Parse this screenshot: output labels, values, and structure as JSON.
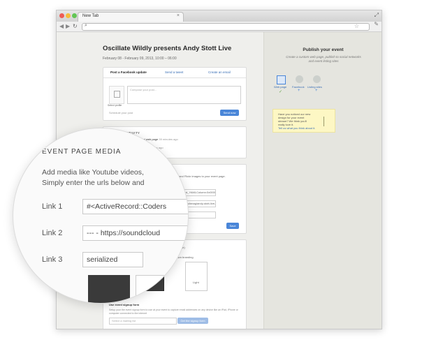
{
  "browser": {
    "tab_title": "New Tab",
    "tab_close": "×",
    "expand_glyph": "⤢",
    "back_glyph": "◀",
    "forward_glyph": "▶",
    "reload_glyph": "↻",
    "search_glyph": "⌕",
    "star_glyph": "☆",
    "wrench_glyph": "✎"
  },
  "event": {
    "title": "Oscillate Wildly presents Andy Stott Live",
    "date": "February 08 - February 09, 2013, 10:00 – 06:00"
  },
  "post_card": {
    "tabs": [
      "Post a Facebook update",
      "Send a tweet",
      "Create an email"
    ],
    "select_profile": "Select profile",
    "placeholder": "Compose your post...",
    "schedule": "Schedule your post",
    "send_button": "Send now"
  },
  "activity": {
    "title": "RECENT ACTIVITY",
    "items": [
      {
        "text": "You published your event web page",
        "time": "39 minutes ago"
      },
      {
        "text": "You created your event:",
        "time": "39 minutes ago"
      }
    ]
  },
  "media": {
    "description_tail": "...ideo, SoundCloud tracks and Flickr images to your event page.",
    "description_tail2": "...and hit Save.",
    "link1": "...ecord::Relation::ActiveRecord_YAMLColumn:0x00000007f43a4>",
    "link2": "...https://soundcloud.com/swifttechmag/andy-stott-live-moogfe",
    "save_button": "Save"
  },
  "design": {
    "title": "YOUR EVENT WEB PAGE",
    "view_link": "(view page)",
    "hint": "...event page to match your own branding",
    "dark_label": "Dark",
    "light_label": "Light",
    "signup_title": "Use event signup form",
    "signup_text": "Setup your the event signup form to use at your event to capture email addresses on any device like an iPad, iPhone or computer connected to the internet",
    "select_placeholder": "Select a mailing list",
    "signup_button": "Get the signup form"
  },
  "sidebar": {
    "title": "Publish your event",
    "desc": "Create a custom web page, publish to social networks and event listing sites",
    "channels": [
      {
        "label": "Web page",
        "mark": "✓"
      },
      {
        "label": "Facebook",
        "mark": "+"
      },
      {
        "label": "Listing sites",
        "mark": "+"
      }
    ],
    "note_lines": [
      "Have you noticed our new",
      "design for your event",
      "stream? We think you'll",
      "really love it."
    ],
    "note_link": "Tell us what you think about it."
  },
  "magnifier": {
    "title": "EVENT PAGE MEDIA",
    "desc_line1": "Add media like Youtube videos,",
    "desc_line2": "Simply enter the urls below and",
    "links": [
      {
        "label": "Link 1",
        "value": "#<ActiveRecord::Coders"
      },
      {
        "label": "Link 2",
        "value": "--- - https://soundcloud"
      },
      {
        "label": "Link 3",
        "value": "serialized"
      }
    ]
  },
  "colors": {
    "accent": "#4a86d8",
    "link": "#3a6fb5",
    "note_bg": "#fdf7c4"
  }
}
